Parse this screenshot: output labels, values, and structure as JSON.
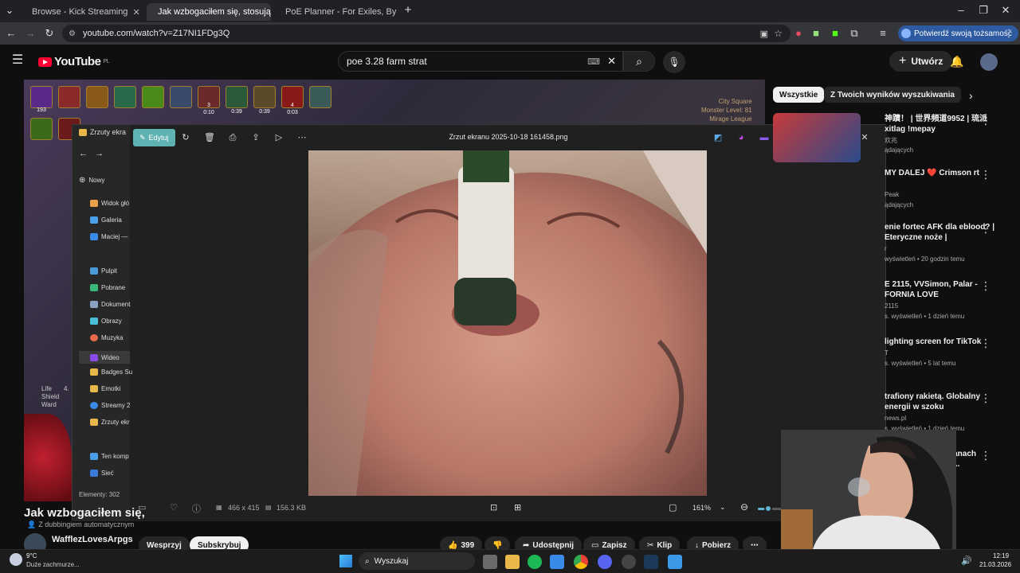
{
  "browser": {
    "tabs": [
      {
        "label": "Browse - Kick Streaming"
      },
      {
        "label": "Jak wzbogaciłem się, stosując t"
      },
      {
        "label": "PoE Planner - For Exiles, By Exil"
      }
    ],
    "url": "youtube.com/watch?v=Z17NI1FDg3Q",
    "verify_label": "Potwierdź swoją tożsamość"
  },
  "youtube": {
    "logo": "YouTube",
    "logo_region": "PL",
    "search_query": "poe 3.28 farm strat",
    "create_label": "Utwórz",
    "video_title": "Jak wzbogaciłem się,",
    "dubbed_label": "Z dubbingiem automatycznym",
    "channel_name": "WafflezLovesArpgs",
    "support_label": "Wesprzyj",
    "subscribe_label": "Subskrybuj",
    "likes": "399",
    "share_label": "Udostępnij",
    "save_label": "Zapisz",
    "clip_label": "Klip",
    "download_label": "Pobierz"
  },
  "game_hud": {
    "buff_counters": [
      "193",
      "3",
      "0:10",
      "0:39",
      "0:39",
      "4",
      "0:03"
    ],
    "map_lines": [
      "City Square",
      "Monster Level: 81",
      "Mirage League"
    ],
    "stats": [
      "Life",
      "Shield",
      "Ward"
    ],
    "stat_value": "4."
  },
  "photos_app": {
    "edit_label": "Edytuj",
    "filename": "Zrzut ekranu 2025-10-18 161458.png",
    "dimensions": "466 x 415",
    "filesize": "156.3 KB",
    "zoom": "161%",
    "zoom_level": 0.15
  },
  "explorer": {
    "folder_title": "Zrzuty ekra",
    "new_label": "Nowy",
    "items": [
      "Widok głó",
      "Galeria",
      "Maciej —",
      "Pulpit",
      "Pobrane",
      "Dokument",
      "Obrazy",
      "Muzyka",
      "Wideo",
      "Badges Su",
      "Emotki",
      "Streamy 2",
      "Zrzuty ekr",
      "Ten komp",
      "Sieć"
    ],
    "status": "Elementy: 302"
  },
  "sidebar": {
    "chips": [
      "Wszystkie",
      "Z Twoich wyników wyszukiwania"
    ],
    "videos": [
      {
        "title": "神蹟！ | 世界頻道9952 | 琉派 xitlag !mepay",
        "meta1": "欢兆",
        "meta2": "ądających"
      },
      {
        "title": "MY DALEJ ❤️ Crimson rt",
        "meta1": "Peak",
        "meta2": "ądających"
      },
      {
        "title": "enie fortec AFK dla eblood? | Eteryczne noże |",
        "meta1": "r",
        "meta2": "wyświetleń • 20 godzin temu"
      },
      {
        "title": "E 2115, VVSimon, Palar - FORNIA LOVE",
        "meta1": "2115",
        "meta2": "s. wyświetleń • 1 dzień temu"
      },
      {
        "title": "lighting screen for TikTok",
        "meta1": "T",
        "meta2": "s. wyświetleń • 5 lat temu"
      },
      {
        "title": "trafiony rakietą. Globalny energii w szoku",
        "meta1": "news.pl",
        "meta2": "s. wyświetleń • 1 dzień temu"
      },
      {
        "title": "ch po zmianach map [PoE...",
        "meta1": "",
        "meta2": ""
      }
    ]
  },
  "taskbar": {
    "weather_temp": "9°C",
    "weather_desc": "Duże zachmurze...",
    "search_label": "Wyszukaj",
    "time": "12:19",
    "date": "21.03.2026"
  }
}
